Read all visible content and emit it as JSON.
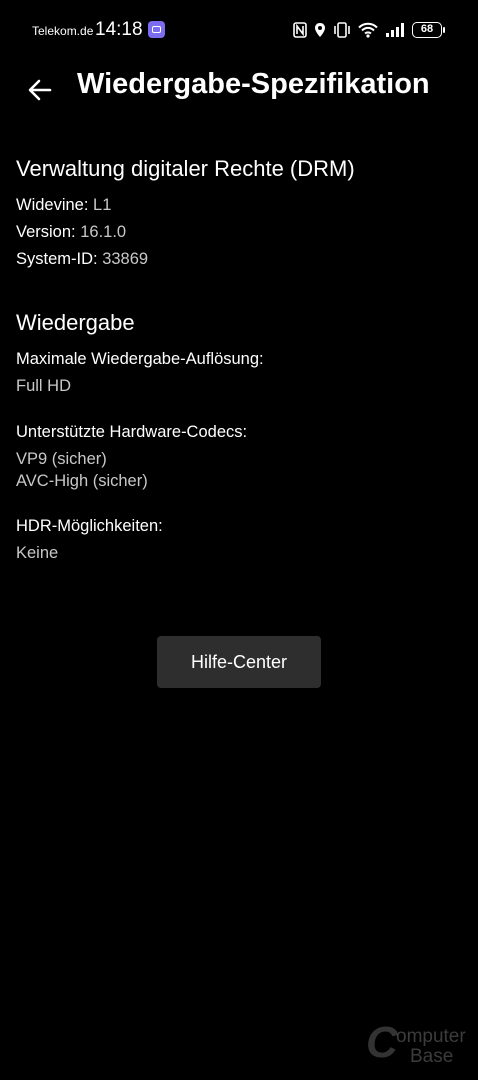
{
  "status_bar": {
    "carrier": "Telekom.de",
    "time": "14:18",
    "battery": "68"
  },
  "header": {
    "title": "Wiedergabe-Spezifikation"
  },
  "drm": {
    "title": "Verwaltung digitaler Rechte (DRM)",
    "items": [
      {
        "key": "Widevine:",
        "value": "L1"
      },
      {
        "key": "Version:",
        "value": "16.1.0"
      },
      {
        "key": "System-ID:",
        "value": "33869"
      }
    ]
  },
  "playback": {
    "title": "Wiedergabe",
    "max_resolution_label": "Maximale Wiedergabe-Auflösung:",
    "max_resolution_value": "Full HD",
    "codecs_label": "Unterstützte Hardware-Codecs:",
    "codecs": [
      "VP9 (sicher)",
      "AVC-High (sicher)"
    ],
    "hdr_label": "HDR-Möglichkeiten:",
    "hdr_value": "Keine"
  },
  "help_button": "Hilfe-Center",
  "watermark": {
    "letter": "C",
    "line1": "omputer",
    "line2": "Base"
  }
}
